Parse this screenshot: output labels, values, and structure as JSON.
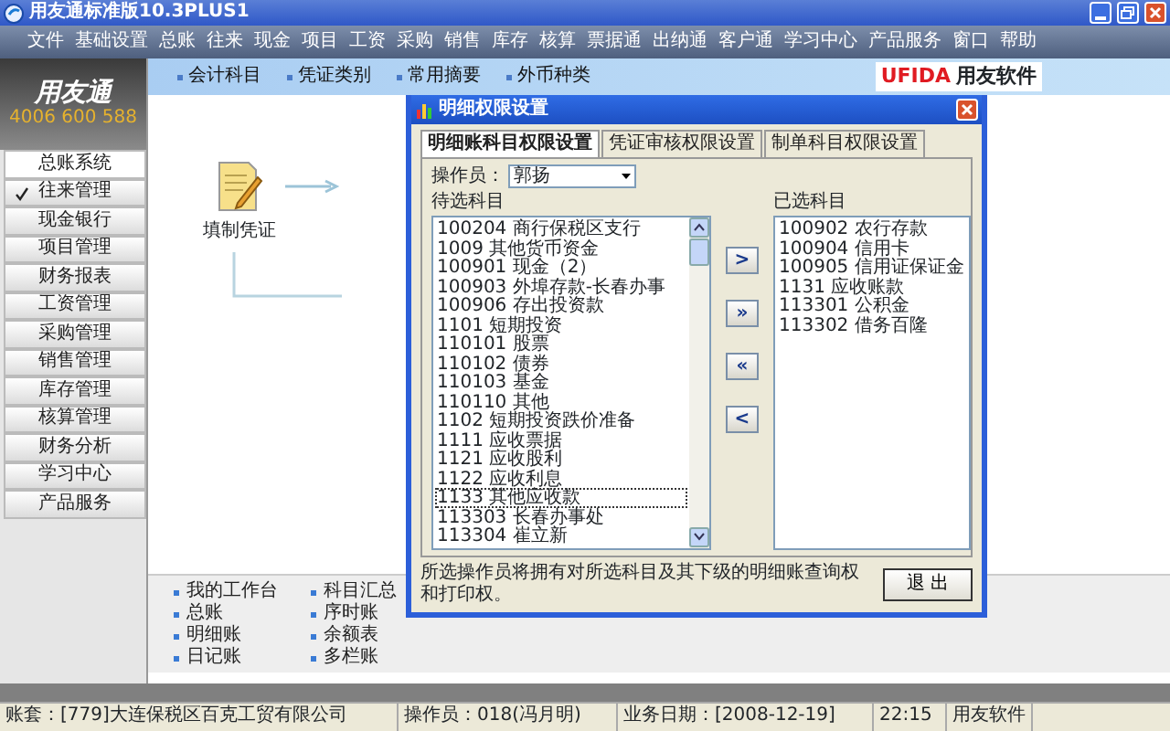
{
  "window": {
    "title": "用友通标准版10.3PLUS1"
  },
  "menu": [
    "文件",
    "基础设置",
    "总账",
    "往来",
    "现金",
    "项目",
    "工资",
    "采购",
    "销售",
    "库存",
    "核算",
    "票据通",
    "出纳通",
    "客户通",
    "学习中心",
    "产品服务",
    "窗口",
    "帮助"
  ],
  "sidebar": {
    "logo_title": "用友通",
    "logo_phone": "4006 600 588",
    "module": "总账系统",
    "items": [
      {
        "label": "往来管理",
        "checked": true
      },
      {
        "label": "现金银行",
        "checked": false
      },
      {
        "label": "项目管理",
        "checked": false
      },
      {
        "label": "财务报表",
        "checked": false
      },
      {
        "label": "工资管理",
        "checked": false
      },
      {
        "label": "采购管理",
        "checked": false
      },
      {
        "label": "销售管理",
        "checked": false
      },
      {
        "label": "库存管理",
        "checked": false
      },
      {
        "label": "核算管理",
        "checked": false
      },
      {
        "label": "财务分析",
        "checked": false
      },
      {
        "label": "学习中心",
        "checked": false
      },
      {
        "label": "产品服务",
        "checked": false
      }
    ]
  },
  "toolbar": {
    "items": [
      "会计科目",
      "凭证类别",
      "常用摘要",
      "外币种类"
    ],
    "brand_mark": "UFIDA",
    "brand_name": "用友软件"
  },
  "flow": {
    "nodes": [
      {
        "label": "填制凭证"
      }
    ]
  },
  "quick_links": [
    [
      "我的工作台",
      "总账",
      "明细账",
      "日记账"
    ],
    [
      "科目汇总",
      "序时账",
      "余额表",
      "多栏账"
    ]
  ],
  "dialog": {
    "title": "明细权限设置",
    "tabs": [
      {
        "label": "明细账科目权限设置",
        "selected": true
      },
      {
        "label": "凭证审核权限设置",
        "selected": false
      },
      {
        "label": "制单科目权限设置",
        "selected": false
      }
    ],
    "operator_label": "操作员：",
    "operator_value": "郭扬",
    "available_label": "待选科目",
    "available": [
      {
        "text": "100204 商行保税区支行",
        "selected": false
      },
      {
        "text": "1009 其他货币资金",
        "selected": false
      },
      {
        "text": "100901 现金（2）",
        "selected": false
      },
      {
        "text": "100903 外埠存款-长春办事",
        "selected": false
      },
      {
        "text": "100906 存出投资款",
        "selected": false
      },
      {
        "text": "1101 短期投资",
        "selected": false
      },
      {
        "text": "110101 股票",
        "selected": false
      },
      {
        "text": "110102 债券",
        "selected": false
      },
      {
        "text": "110103 基金",
        "selected": false
      },
      {
        "text": "110110 其他",
        "selected": false
      },
      {
        "text": "1102 短期投资跌价准备",
        "selected": false
      },
      {
        "text": "1111 应收票据",
        "selected": false
      },
      {
        "text": "1121 应收股利",
        "selected": false
      },
      {
        "text": "1122 应收利息",
        "selected": false
      },
      {
        "text": "1133 其他应收款",
        "selected": true
      },
      {
        "text": "113303 长春办事处",
        "selected": false
      },
      {
        "text": "113304 崔立新",
        "selected": false
      }
    ],
    "move_buttons": [
      ">",
      "»",
      "«",
      "<"
    ],
    "chosen_label": "已选科目",
    "chosen": [
      "100902 农行存款",
      "100904 信用卡",
      "100905 信用证保证金",
      "1131 应收账款",
      "113301 公积金",
      "113302 借务百隆"
    ],
    "note": "所选操作员将拥有对所选科目及其下级的明细账查询权和打印权。",
    "exit_button": "退 出"
  },
  "status_bar": [
    "账套：[779]大连保税区百克工贸有限公司",
    "操作员：018(冯月明)",
    "业务日期：[2008-12-19]",
    "22:15",
    "用友软件"
  ]
}
